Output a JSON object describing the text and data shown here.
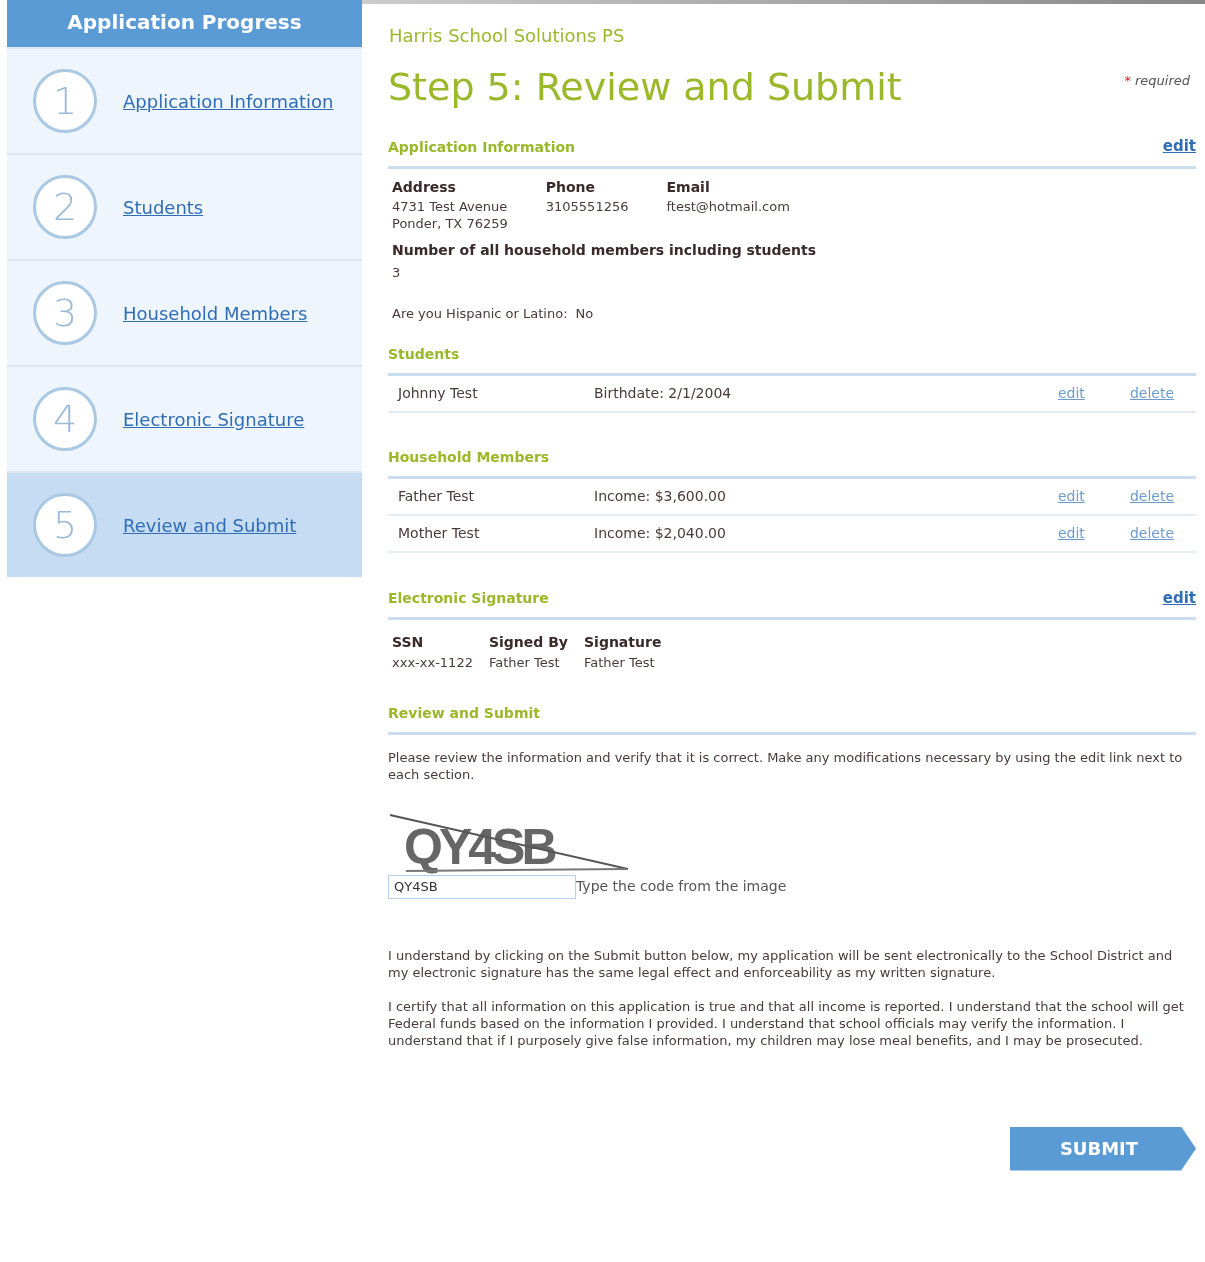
{
  "sidebar": {
    "title": "Application Progress",
    "steps": [
      {
        "number": "1",
        "label": "Application Information",
        "selected": false
      },
      {
        "number": "2",
        "label": "Students",
        "selected": false
      },
      {
        "number": "3",
        "label": "Household Members",
        "selected": false
      },
      {
        "number": "4",
        "label": "Electronic Signature",
        "selected": false
      },
      {
        "number": "5",
        "label": "Review and Submit",
        "selected": true
      }
    ]
  },
  "school": "Harris School Solutions PS",
  "page_title": "Step 5: Review and Submit",
  "required_note": {
    "mark": "*",
    "text": "required"
  },
  "application_information": {
    "heading": "Application Information",
    "edit": "edit",
    "fields": [
      {
        "label": "Address",
        "lines": [
          "4731 Test Avenue",
          "Ponder, TX  76259"
        ]
      },
      {
        "label": "Phone",
        "lines": [
          "3105551256"
        ]
      },
      {
        "label": "Email",
        "lines": [
          "ftest@hotmail.com"
        ]
      }
    ],
    "household_count": {
      "label": "Number of all household members including students",
      "value": "3"
    },
    "hispanic": {
      "label": "Are you Hispanic or Latino:",
      "value": "No"
    }
  },
  "students": {
    "heading": "Students",
    "rows": [
      {
        "name": "Johnny Test",
        "detail": "Birthdate: 2/1/2004",
        "edit": "edit",
        "delete": "delete"
      }
    ]
  },
  "household_members": {
    "heading": "Household Members",
    "rows": [
      {
        "name": "Father Test",
        "detail": "Income: $3,600.00",
        "edit": "edit",
        "delete": "delete"
      },
      {
        "name": "Mother Test",
        "detail": "Income: $2,040.00",
        "edit": "edit",
        "delete": "delete"
      }
    ]
  },
  "electronic_signature": {
    "heading": "Electronic Signature",
    "edit": "edit",
    "fields": [
      {
        "label": "SSN",
        "value": "xxx-xx-1122"
      },
      {
        "label": "Signed By",
        "value": "Father Test"
      },
      {
        "label": "Signature",
        "value": "Father Test"
      }
    ]
  },
  "review": {
    "heading": "Review and Submit",
    "instructions": "Please review the information and verify that it is correct. Make any modifications necessary by using the edit link next to each section.",
    "captcha": "QY4SB",
    "captcha_input": "QY4SB",
    "captcha_hint": "Type the code from the image",
    "paragraphs": [
      "I understand by clicking on the Submit button below, my application will be sent electronically to the School District and my electronic signature has the same legal effect and enforceability as my written signature.",
      "I certify that all information on this application is true and that all income is reported. I understand that the school will get Federal funds based on the information I provided. I understand that school officials may verify the information. I understand that if I purposely give false information, my children may lose meal benefits, and I may be prosecuted."
    ]
  },
  "submit": "SUBMIT"
}
